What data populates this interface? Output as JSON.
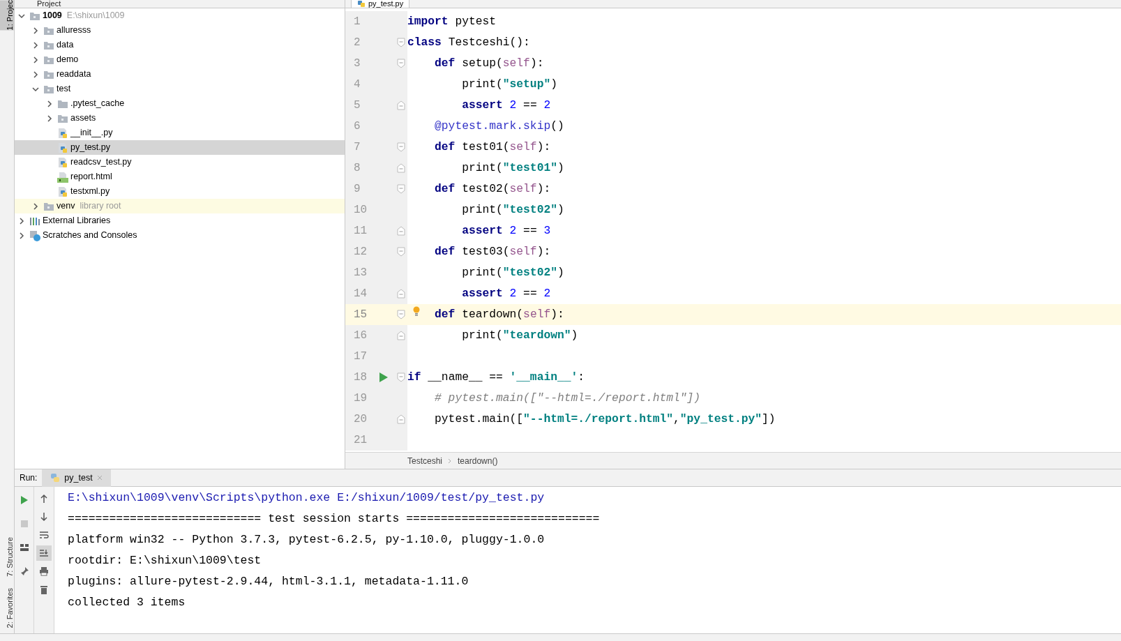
{
  "side_strip": {
    "tabs": [
      {
        "label": "1: Projec",
        "selected": true
      },
      {
        "label": "7: Structure",
        "selected": false
      },
      {
        "label": "2: Favorites",
        "selected": false
      }
    ]
  },
  "project_panel": {
    "title": "Project",
    "tree": [
      {
        "label": "1009",
        "hint": "E:\\shixun\\1009",
        "kind": "folder",
        "expanded": true,
        "selected": false,
        "children": [
          {
            "label": "alluresss",
            "kind": "folder",
            "expanded": false,
            "selected": false
          },
          {
            "label": "data",
            "kind": "folder",
            "expanded": false,
            "selected": false
          },
          {
            "label": "demo",
            "kind": "folder",
            "expanded": false,
            "selected": false
          },
          {
            "label": "readdata",
            "kind": "folder",
            "expanded": false,
            "selected": false
          },
          {
            "label": "test",
            "kind": "folder",
            "expanded": true,
            "selected": false,
            "children": [
              {
                "label": ".pytest_cache",
                "kind": "plain_folder",
                "expanded": false,
                "selected": false
              },
              {
                "label": "assets",
                "kind": "folder",
                "expanded": false,
                "selected": false
              },
              {
                "label": "__init__.py",
                "kind": "python",
                "selected": false
              },
              {
                "label": "py_test.py",
                "kind": "python",
                "selected": true
              },
              {
                "label": "readcsv_test.py",
                "kind": "python",
                "selected": false
              },
              {
                "label": "report.html",
                "kind": "html",
                "selected": false
              },
              {
                "label": "testxml.py",
                "kind": "python",
                "selected": false
              }
            ]
          },
          {
            "label": "venv",
            "hint": "library root",
            "kind": "library_root",
            "expanded": false,
            "selected": false
          }
        ]
      },
      {
        "label": "External Libraries",
        "kind": "libraries",
        "expanded": false,
        "selected": false
      },
      {
        "label": "Scratches and Consoles",
        "kind": "scratches",
        "expanded": false,
        "selected": false
      }
    ]
  },
  "editor": {
    "tab": {
      "label": "py_test.py",
      "selected": true
    },
    "lines": [
      {
        "number": "1",
        "current": false,
        "fold_start": false,
        "fold_end": false,
        "bulb": false,
        "run_button": false,
        "tokens": [
          {
            "kind": "keyword",
            "text": "import"
          },
          {
            "kind": "plain",
            "text": " pytest"
          }
        ]
      },
      {
        "number": "2",
        "current": false,
        "fold_start": true,
        "fold_end": false,
        "bulb": false,
        "run_button": false,
        "tokens": [
          {
            "kind": "keyword",
            "text": "class"
          },
          {
            "kind": "plain",
            "text": " Testceshi():"
          }
        ]
      },
      {
        "number": "3",
        "current": false,
        "fold_start": true,
        "fold_end": false,
        "bulb": false,
        "run_button": false,
        "tokens": [
          {
            "kind": "keyword",
            "text": "    def"
          },
          {
            "kind": "plain",
            "text": " setup("
          },
          {
            "kind": "self",
            "text": "self"
          },
          {
            "kind": "plain",
            "text": "):"
          }
        ]
      },
      {
        "number": "4",
        "current": false,
        "fold_start": false,
        "fold_end": false,
        "bulb": false,
        "run_button": false,
        "tokens": [
          {
            "kind": "plain",
            "text": "        print("
          },
          {
            "kind": "string",
            "text": "\"setup\""
          },
          {
            "kind": "plain",
            "text": ")"
          }
        ]
      },
      {
        "number": "5",
        "current": false,
        "fold_start": false,
        "fold_end": true,
        "bulb": false,
        "run_button": false,
        "tokens": [
          {
            "kind": "keyword",
            "text": "        assert "
          },
          {
            "kind": "number",
            "text": "2"
          },
          {
            "kind": "plain",
            "text": " == "
          },
          {
            "kind": "number",
            "text": "2"
          }
        ]
      },
      {
        "number": "6",
        "current": false,
        "fold_start": false,
        "fold_end": false,
        "bulb": false,
        "run_button": false,
        "tokens": [
          {
            "kind": "decorator",
            "text": "    @pytest.mark.skip"
          },
          {
            "kind": "plain",
            "text": "()"
          }
        ]
      },
      {
        "number": "7",
        "current": false,
        "fold_start": true,
        "fold_end": false,
        "bulb": false,
        "run_button": false,
        "tokens": [
          {
            "kind": "keyword",
            "text": "    def"
          },
          {
            "kind": "plain",
            "text": " test01("
          },
          {
            "kind": "self",
            "text": "self"
          },
          {
            "kind": "plain",
            "text": "):"
          }
        ]
      },
      {
        "number": "8",
        "current": false,
        "fold_start": false,
        "fold_end": true,
        "bulb": false,
        "run_button": false,
        "tokens": [
          {
            "kind": "plain",
            "text": "        print("
          },
          {
            "kind": "string",
            "text": "\"test01\""
          },
          {
            "kind": "plain",
            "text": ")"
          }
        ]
      },
      {
        "number": "9",
        "current": false,
        "fold_start": true,
        "fold_end": false,
        "bulb": false,
        "run_button": false,
        "tokens": [
          {
            "kind": "keyword",
            "text": "    def"
          },
          {
            "kind": "plain",
            "text": " test02("
          },
          {
            "kind": "self",
            "text": "self"
          },
          {
            "kind": "plain",
            "text": "):"
          }
        ]
      },
      {
        "number": "10",
        "current": false,
        "fold_start": false,
        "fold_end": false,
        "bulb": false,
        "run_button": false,
        "tokens": [
          {
            "kind": "plain",
            "text": "        print("
          },
          {
            "kind": "string",
            "text": "\"test02\""
          },
          {
            "kind": "plain",
            "text": ")"
          }
        ]
      },
      {
        "number": "11",
        "current": false,
        "fold_start": false,
        "fold_end": true,
        "bulb": false,
        "run_button": false,
        "tokens": [
          {
            "kind": "keyword",
            "text": "        assert "
          },
          {
            "kind": "number",
            "text": "2"
          },
          {
            "kind": "plain",
            "text": " == "
          },
          {
            "kind": "number",
            "text": "3"
          }
        ]
      },
      {
        "number": "12",
        "current": false,
        "fold_start": true,
        "fold_end": false,
        "bulb": false,
        "run_button": false,
        "tokens": [
          {
            "kind": "keyword",
            "text": "    def"
          },
          {
            "kind": "plain",
            "text": " test03("
          },
          {
            "kind": "self",
            "text": "self"
          },
          {
            "kind": "plain",
            "text": "):"
          }
        ]
      },
      {
        "number": "13",
        "current": false,
        "fold_start": false,
        "fold_end": false,
        "bulb": false,
        "run_button": false,
        "tokens": [
          {
            "kind": "plain",
            "text": "        print("
          },
          {
            "kind": "string",
            "text": "\"test02\""
          },
          {
            "kind": "plain",
            "text": ")"
          }
        ]
      },
      {
        "number": "14",
        "current": false,
        "fold_start": false,
        "fold_end": true,
        "bulb": false,
        "run_button": false,
        "tokens": [
          {
            "kind": "keyword",
            "text": "        assert "
          },
          {
            "kind": "number",
            "text": "2"
          },
          {
            "kind": "plain",
            "text": " == "
          },
          {
            "kind": "number",
            "text": "2"
          }
        ]
      },
      {
        "number": "15",
        "current": true,
        "fold_start": true,
        "fold_end": false,
        "bulb": true,
        "run_button": false,
        "tokens": [
          {
            "kind": "keyword",
            "text": "    def"
          },
          {
            "kind": "plain",
            "text": " teardown("
          },
          {
            "kind": "self",
            "text": "self"
          },
          {
            "kind": "plain",
            "text": "):"
          }
        ]
      },
      {
        "number": "16",
        "current": false,
        "fold_start": false,
        "fold_end": true,
        "bulb": false,
        "run_button": false,
        "tokens": [
          {
            "kind": "plain",
            "text": "        print("
          },
          {
            "kind": "string",
            "text": "\"teardown\""
          },
          {
            "kind": "plain",
            "text": ")"
          }
        ]
      },
      {
        "number": "17",
        "current": false,
        "fold_start": false,
        "fold_end": false,
        "bulb": false,
        "run_button": false
      },
      {
        "number": "18",
        "current": false,
        "fold_start": true,
        "fold_end": false,
        "bulb": false,
        "run_button": true,
        "tokens": [
          {
            "kind": "keyword",
            "text": "if"
          },
          {
            "kind": "plain",
            "text": " __name__ == "
          },
          {
            "kind": "string",
            "text": "'__main__'"
          },
          {
            "kind": "plain",
            "text": ":"
          }
        ]
      },
      {
        "number": "19",
        "current": false,
        "fold_start": false,
        "fold_end": false,
        "bulb": false,
        "run_button": false,
        "tokens": [
          {
            "kind": "comment",
            "text": "    # pytest.main([\"--html=./report.html\"])"
          }
        ]
      },
      {
        "number": "20",
        "current": false,
        "fold_start": false,
        "fold_end": true,
        "bulb": false,
        "run_button": false,
        "tokens": [
          {
            "kind": "plain",
            "text": "    pytest.main(["
          },
          {
            "kind": "string",
            "text": "\"--html=./report.html\""
          },
          {
            "kind": "plain",
            "text": ","
          },
          {
            "kind": "string",
            "text": "\"py_test.py\""
          },
          {
            "kind": "plain",
            "text": "])"
          }
        ]
      },
      {
        "number": "21",
        "current": false,
        "fold_start": false,
        "fold_end": false,
        "bulb": false,
        "run_button": false
      }
    ],
    "breadcrumbs": [
      "Testceshi",
      "teardown()"
    ]
  },
  "run_panel": {
    "label": "Run:",
    "tab": {
      "label": "py_test",
      "selected": true
    },
    "scroll_to_end_on": true,
    "console": [
      {
        "kind": "command",
        "text": "E:\\shixun\\1009\\venv\\Scripts\\python.exe E:/shixun/1009/test/py_test.py"
      },
      {
        "kind": "output",
        "text": "============================ test session starts ============================"
      },
      {
        "kind": "output",
        "text": "platform win32 -- Python 3.7.3, pytest-6.2.5, py-1.10.0, pluggy-1.0.0"
      },
      {
        "kind": "output",
        "text": "rootdir: E:\\shixun\\1009\\test"
      },
      {
        "kind": "output",
        "text": "plugins: allure-pytest-2.9.44, html-3.1.1, metadata-1.11.0"
      },
      {
        "kind": "output",
        "text": "collected 3 items"
      }
    ]
  }
}
